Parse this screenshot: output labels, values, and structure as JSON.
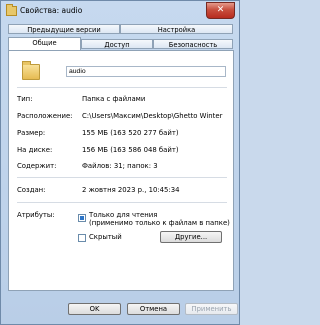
{
  "window": {
    "title": "Свойства: audio",
    "close_symbol": "✕"
  },
  "tabs": {
    "row1": [
      "Предыдущие версии",
      "Настройка"
    ],
    "row2": [
      "Общие",
      "Доступ",
      "Безопасность"
    ]
  },
  "general": {
    "folder_name": "audio",
    "type_label": "Тип:",
    "type_value": "Папка с файлами",
    "location_label": "Расположение:",
    "location_value": "C:\\Users\\Максим\\Desktop\\Ghetto Winter",
    "size_label": "Размер:",
    "size_value": "155 МБ (163 520 277 байт)",
    "disk_size_label": "На диске:",
    "disk_size_value": "156 МБ (163 586 048 байт)",
    "contains_label": "Содержит:",
    "contains_value": "Файлов: 31; папок: 3",
    "created_label": "Создан:",
    "created_value": "2 жовтня 2023 р., 10:45:34",
    "attributes_label": "Атрибуты:",
    "readonly_label": "Только для чтения",
    "readonly_note": "(применимо только к файлам в папке)",
    "hidden_label": "Скрытый",
    "other_button": "Другие..."
  },
  "footer": {
    "ok": "OK",
    "cancel": "Отмена",
    "apply": "Применить"
  }
}
